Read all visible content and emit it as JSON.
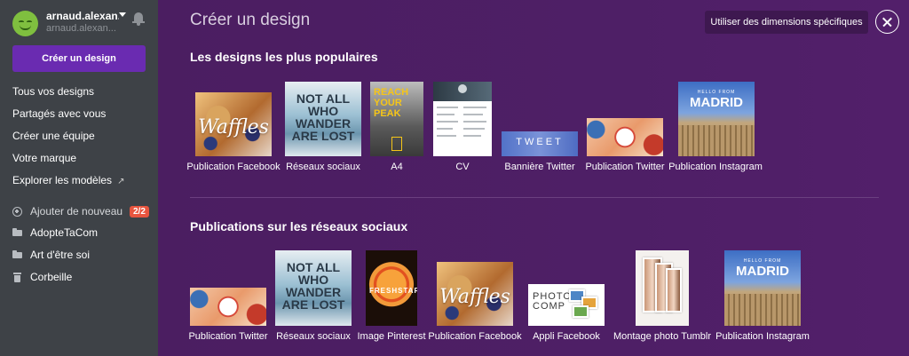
{
  "sidebar": {
    "profile": {
      "name": "arnaud.alexan...",
      "email": "arnaud.alexan..."
    },
    "create_button": "Créer un design",
    "nav": [
      {
        "label": "Tous vos designs"
      },
      {
        "label": "Partagés avec vous"
      },
      {
        "label": "Créer une équipe"
      },
      {
        "label": "Votre marque"
      },
      {
        "label": "Explorer les modèles",
        "ext_icon": "↗"
      }
    ],
    "add_team": {
      "label": "Ajouter de nouveau...",
      "badge": "2/2"
    },
    "folders": [
      {
        "label": "AdopteTaCom"
      },
      {
        "label": "Art d'être soi"
      }
    ],
    "trash": {
      "label": "Corbeille"
    }
  },
  "main": {
    "title": "Créer un design",
    "custom_dims_button": "Utiliser des dimensions spécifiques",
    "sections": [
      {
        "title": "Les designs les plus populaires",
        "items": [
          {
            "label": "Publication Facebook",
            "art": "Waffles"
          },
          {
            "label": "Réseaux sociaux",
            "art": "NOT ALL WHO WANDER ARE LOST"
          },
          {
            "label": "A4",
            "art": "REACH YOUR PEAK"
          },
          {
            "label": "CV",
            "art": ""
          },
          {
            "label": "Bannière Twitter",
            "art": "TWEET"
          },
          {
            "label": "Publication Twitter",
            "art": ""
          },
          {
            "label": "Publication Instagram",
            "art": "MADRID",
            "art_small": "HELLO FROM"
          }
        ]
      },
      {
        "title": "Publications sur les réseaux sociaux",
        "items": [
          {
            "label": "Publication Twitter",
            "art": ""
          },
          {
            "label": "Réseaux sociaux",
            "art": "NOT ALL WHO WANDER ARE LOST"
          },
          {
            "label": "Image Pinterest",
            "art": "FRESHSTART"
          },
          {
            "label": "Publication Facebook",
            "art": "Waffles"
          },
          {
            "label": "Appli Facebook",
            "art": "PHOTO COMP"
          },
          {
            "label": "Montage photo Tumblr",
            "art": ""
          },
          {
            "label": "Publication Instagram",
            "art": "MADRID",
            "art_small": "HELLO FROM"
          }
        ]
      }
    ]
  },
  "colors": {
    "sidebar_bg": "#3e4247",
    "main_bg": "#4e1f66",
    "accent": "#6a2bb1",
    "badge": "#e8553f"
  }
}
